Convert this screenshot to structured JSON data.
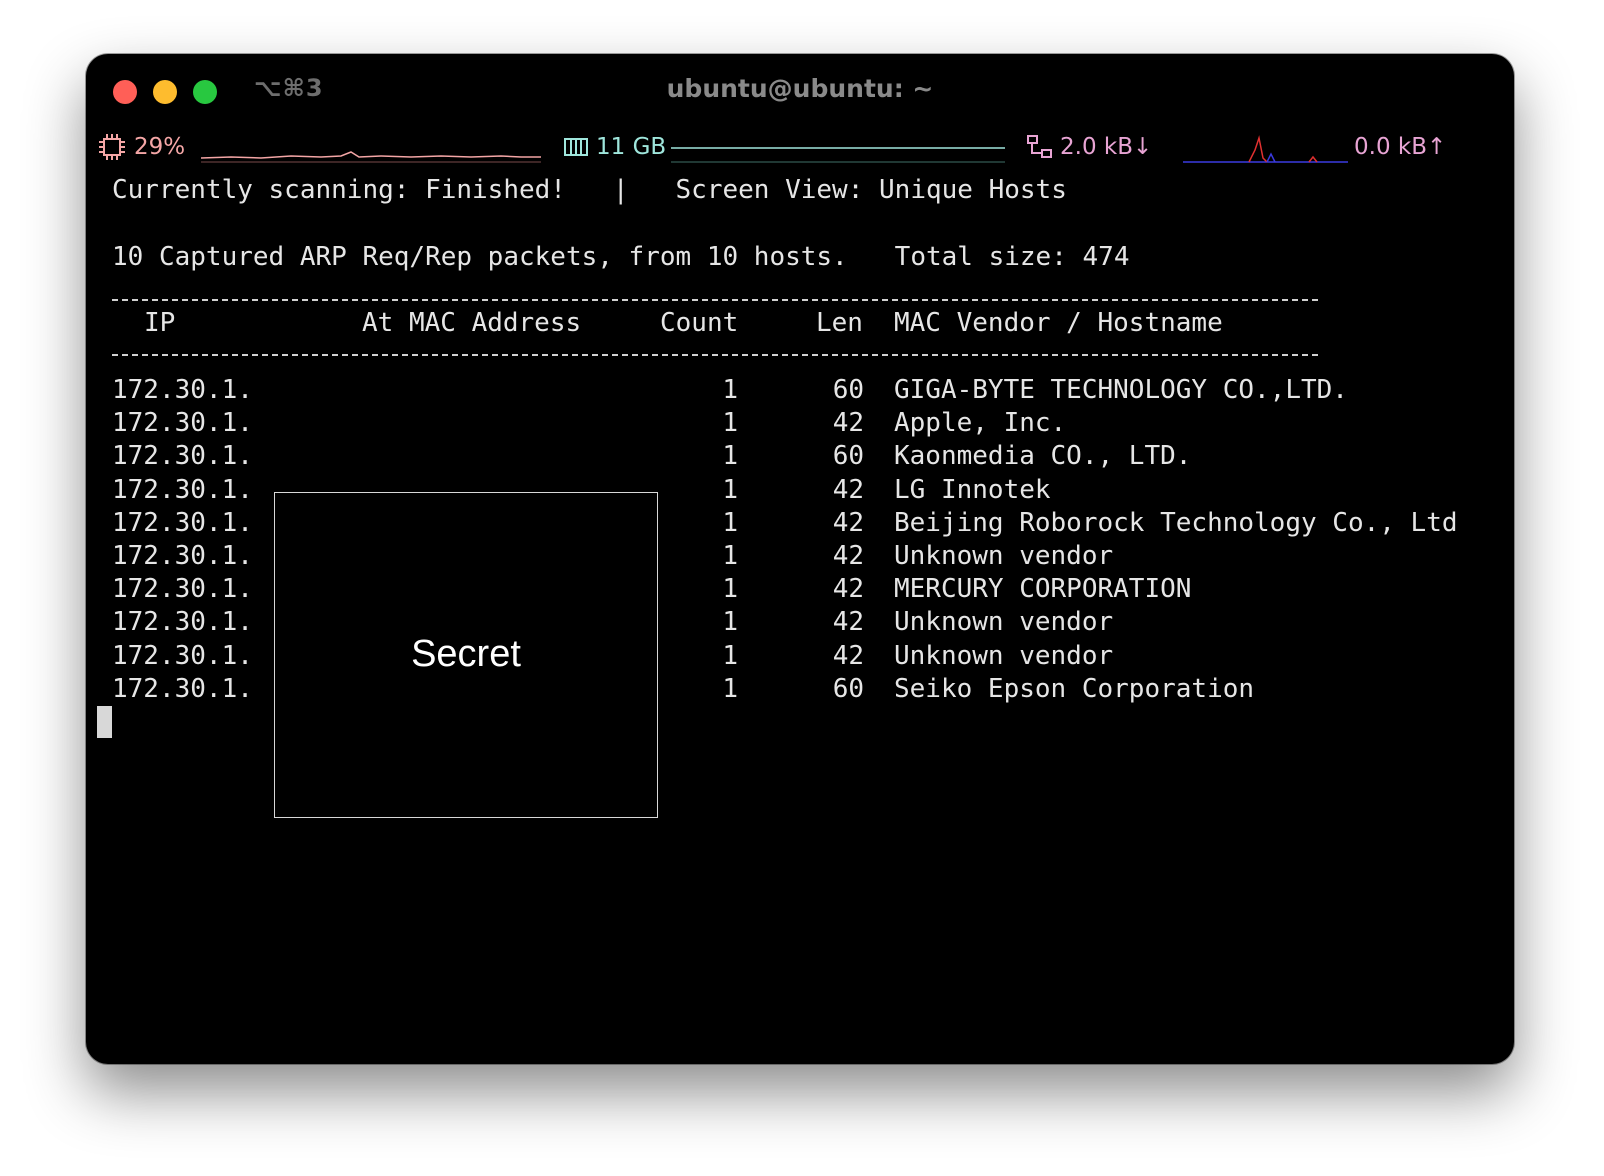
{
  "window": {
    "shortcut": "⌥⌘3",
    "title": "ubuntu@ubuntu: ~"
  },
  "status_bar": {
    "cpu": {
      "icon": "cpu-chip-icon",
      "value": "29%",
      "color": "#f4a6a6"
    },
    "memory": {
      "icon": "memory-icon",
      "value": "11 GB",
      "color": "#9fe6dc"
    },
    "network": {
      "icon": "network-icon",
      "download": "2.0 kB↓",
      "upload": "0.0 kB↑",
      "download_color": "#e8a4d4",
      "graph_colors": [
        "#3a3adf",
        "#e03030"
      ]
    }
  },
  "scan": {
    "status_line": "Currently scanning: Finished!   |   Screen View: Unique Hosts",
    "summary_line": "10 Captured ARP Req/Rep packets, from 10 hosts.   Total size: 474"
  },
  "table": {
    "headers": {
      "ip": "IP",
      "mac": "At MAC Address",
      "count": "Count",
      "len": "Len",
      "vendor": "MAC Vendor / Hostname"
    },
    "rows": [
      {
        "ip": "172.30.1.",
        "count": "1",
        "len": "60",
        "vendor": "GIGA-BYTE TECHNOLOGY CO.,LTD."
      },
      {
        "ip": "172.30.1.",
        "count": "1",
        "len": "42",
        "vendor": "Apple, Inc."
      },
      {
        "ip": "172.30.1.",
        "count": "1",
        "len": "60",
        "vendor": "Kaonmedia CO., LTD."
      },
      {
        "ip": "172.30.1.",
        "count": "1",
        "len": "42",
        "vendor": "LG Innotek"
      },
      {
        "ip": "172.30.1.",
        "count": "1",
        "len": "42",
        "vendor": "Beijing Roborock Technology Co., Ltd"
      },
      {
        "ip": "172.30.1.",
        "count": "1",
        "len": "42",
        "vendor": "Unknown vendor"
      },
      {
        "ip": "172.30.1.",
        "count": "1",
        "len": "42",
        "vendor": "MERCURY CORPORATION"
      },
      {
        "ip": "172.30.1.",
        "count": "1",
        "len": "42",
        "vendor": "Unknown vendor"
      },
      {
        "ip": "172.30.1.",
        "count": "1",
        "len": "42",
        "vendor": "Unknown vendor"
      },
      {
        "ip": "172.30.1.",
        "count": "1",
        "len": "60",
        "vendor": "Seiko Epson Corporation"
      }
    ]
  },
  "redaction": {
    "label": "Secret"
  }
}
